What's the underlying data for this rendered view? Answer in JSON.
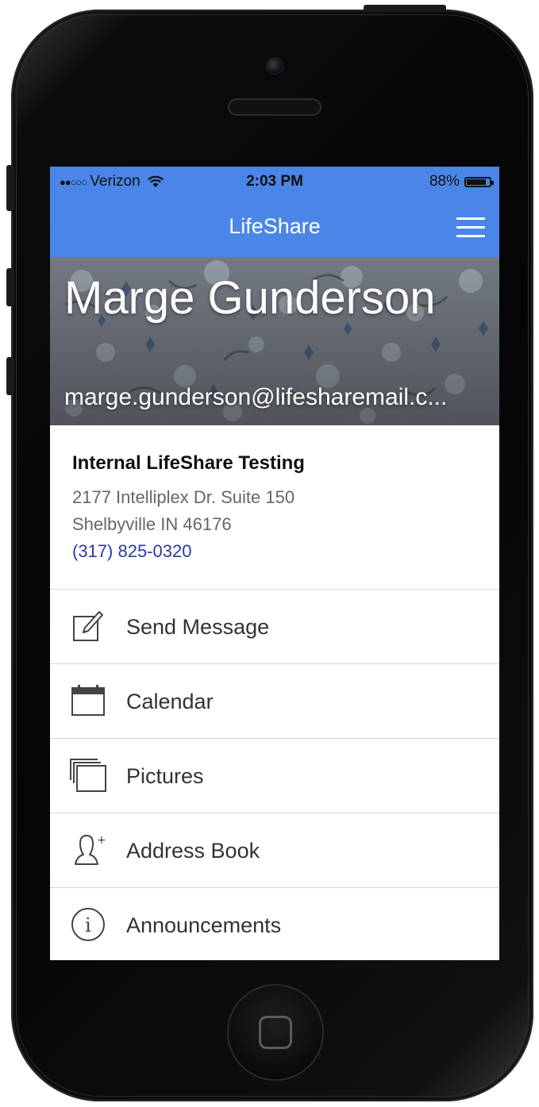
{
  "status_bar": {
    "signal_dots": "●●○○○",
    "carrier": "Verizon",
    "wifi_icon": "wifi-icon",
    "time": "2:03 PM",
    "battery": "88%",
    "battery_level": 0.88
  },
  "nav": {
    "title": "LifeShare",
    "menu_icon": "hamburger-menu-icon"
  },
  "profile": {
    "name": "Marge Gunderson",
    "email": "marge.gunderson@lifesharemail.c..."
  },
  "organization": {
    "name": "Internal LifeShare Testing",
    "address_line1": "2177 Intelliplex Dr. Suite 150",
    "address_line2": "Shelbyville IN 46176",
    "phone": "(317) 825-0320"
  },
  "menu": {
    "items": [
      {
        "label": "Send Message",
        "icon": "compose-icon"
      },
      {
        "label": "Calendar",
        "icon": "calendar-icon"
      },
      {
        "label": "Pictures",
        "icon": "pictures-icon"
      },
      {
        "label": "Address Book",
        "icon": "address-book-icon"
      },
      {
        "label": "Announcements",
        "icon": "info-icon"
      }
    ]
  },
  "colors": {
    "header_blue": "#4a86e8",
    "phone_link": "#2b3aa8"
  }
}
